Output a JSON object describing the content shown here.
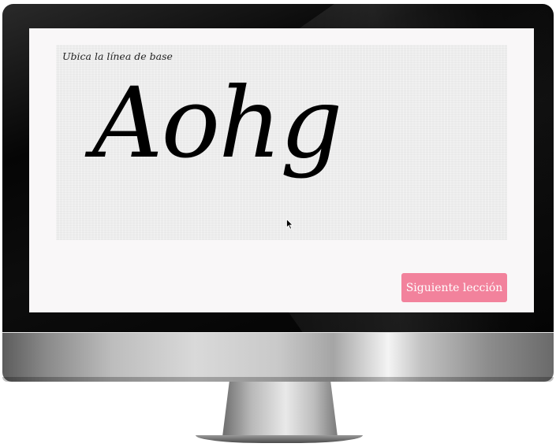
{
  "lesson": {
    "instruction": "Ubica la línea de base",
    "specimen_text": "Aohg"
  },
  "actions": {
    "next_label": "Siguiente lección"
  },
  "colors": {
    "screen_background": "#f9f7f8",
    "panel_background": "#ededed",
    "button_background": "#f2829c",
    "button_text": "#ffffff",
    "specimen_text": "#000000"
  },
  "icons": {
    "cursor": "mouse-pointer-icon"
  }
}
